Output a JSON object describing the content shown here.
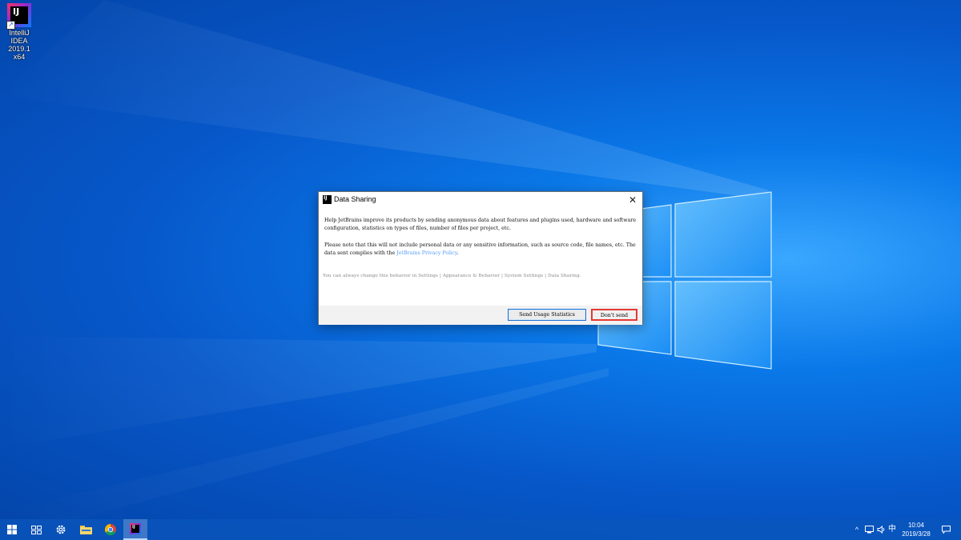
{
  "desktop": {
    "icons": [
      {
        "label_line1": "IntelliJ IDEA",
        "label_line2": "2019.1 x64",
        "glyph": "IJ"
      }
    ]
  },
  "dialog": {
    "title": "Data Sharing",
    "app_glyph": "IJ",
    "close_glyph": "✕",
    "paragraph1": "Help JetBrains improve its products by sending anonymous data about features and plugins used, hardware and software configuration, statistics on types of files, number of files per project, etc.",
    "paragraph2_prefix": "Please note that this will not include personal data or any sensitive information, such as source code, file names, etc. The data sent complies with the ",
    "paragraph2_link": "JetBrains Privacy Policy",
    "paragraph2_suffix": ".",
    "hint": "You can always change this behavior in Settings | Appearance & Behavior | System Settings | Data Sharing.",
    "buttons": {
      "send_label": "Send Usage Statistics",
      "dont_send_label": "Don't send"
    }
  },
  "taskbar": {
    "items": [
      {
        "name": "start",
        "icon": "windows-logo-icon"
      },
      {
        "name": "task-view",
        "icon": "task-view-icon"
      },
      {
        "name": "settings",
        "icon": "gear-icon"
      },
      {
        "name": "file-explorer",
        "icon": "folder-icon"
      },
      {
        "name": "chrome",
        "icon": "chrome-icon"
      },
      {
        "name": "intellij",
        "icon": "intellij-icon",
        "glyph": "IJ",
        "active": true
      }
    ],
    "tray": {
      "chevron": "^",
      "ime": "中",
      "time": "10:04",
      "date": "2019/3/28"
    }
  },
  "colors": {
    "desktop_blue": "#0757c9",
    "link": "#589df6",
    "dont_send_border": "#e53935",
    "send_border": "#1d6fd1"
  }
}
